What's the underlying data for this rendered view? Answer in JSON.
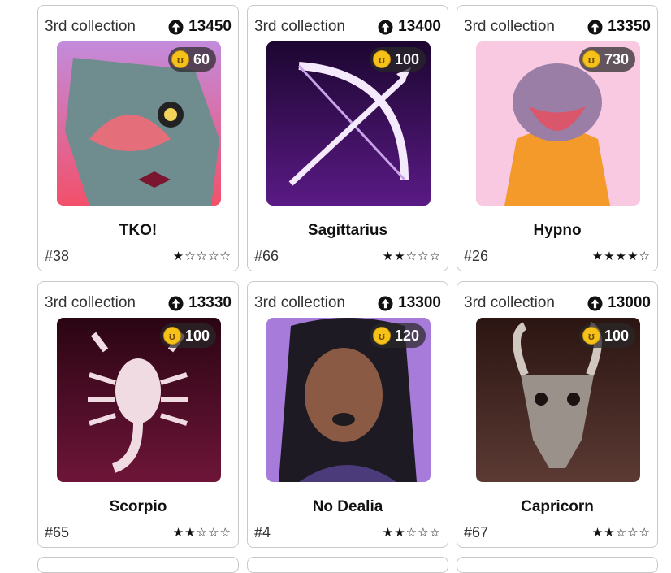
{
  "cards": [
    {
      "collection": "3rd collection",
      "score": "13450",
      "price": "60",
      "name": "TKO!",
      "number": "#38",
      "stars": "★☆☆☆☆",
      "art": "shark-art",
      "bg": "#e05a80"
    },
    {
      "collection": "3rd collection",
      "score": "13400",
      "price": "100",
      "name": "Sagittarius",
      "number": "#66",
      "stars": "★★☆☆☆",
      "art": "bow-arrow-art",
      "bg": "#3a0d5c"
    },
    {
      "collection": "3rd collection",
      "score": "13350",
      "price": "730",
      "name": "Hypno",
      "number": "#26",
      "stars": "★★★★☆",
      "art": "hippo-art",
      "bg": "#f7c6e0"
    },
    {
      "collection": "3rd collection",
      "score": "13330",
      "price": "100",
      "name": "Scorpio",
      "number": "#65",
      "stars": "★★☆☆☆",
      "art": "scorpion-art",
      "bg": "#4e0b2a"
    },
    {
      "collection": "3rd collection",
      "score": "13300",
      "price": "120",
      "name": "No Dealia",
      "number": "#4",
      "stars": "★★☆☆☆",
      "art": "woman-art",
      "bg": "#a77bd9"
    },
    {
      "collection": "3rd collection",
      "score": "13000",
      "price": "100",
      "name": "Capricorn",
      "number": "#67",
      "stars": "★★☆☆☆",
      "art": "goat-skull-art",
      "bg": "#3b1f1a"
    }
  ],
  "icons": {
    "score": "arrow-up-circle-icon",
    "price": "coin-icon"
  },
  "coin_glyph": "ʊ"
}
